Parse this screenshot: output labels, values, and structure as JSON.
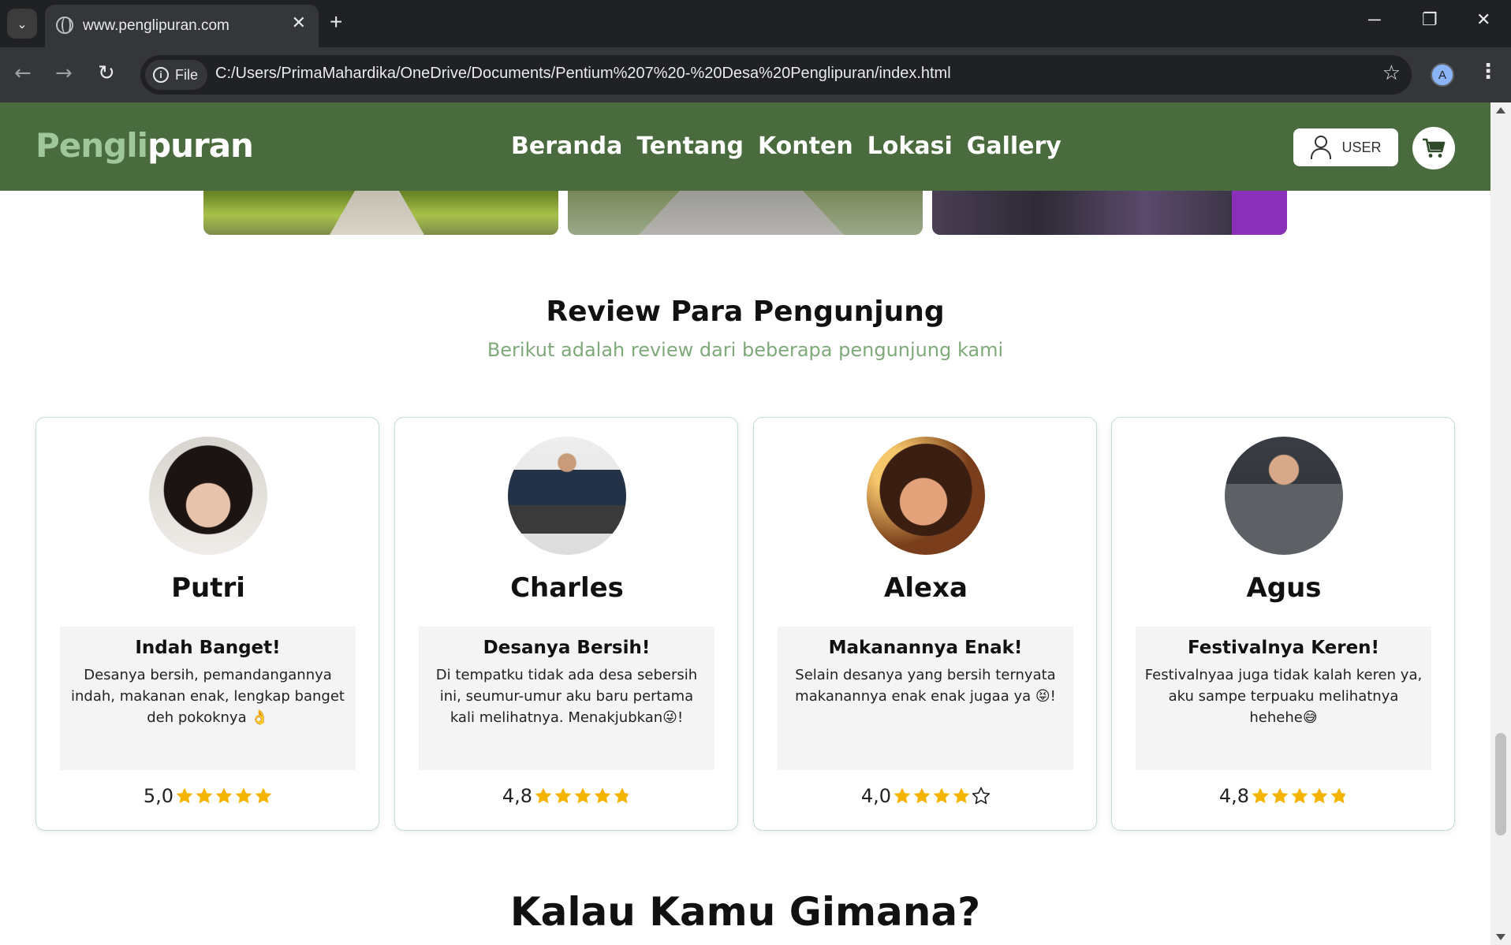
{
  "browser": {
    "tab_title": "www.penglipuran.com",
    "omnibox_chip": "File",
    "url": "C:/Users/PrimaMahardika/OneDrive/Documents/Pentium%207%20-%20Desa%20Penglipuran/index.html",
    "profile_initial": "A"
  },
  "site": {
    "logo_part1": "Pengli",
    "logo_part2": "puran",
    "nav": [
      "Beranda",
      "Tentang",
      "Konten",
      "Lokasi",
      "Gallery"
    ],
    "user_label": "USER",
    "colors": {
      "header": "#4a6b3d",
      "accent": "#7fa97a",
      "star": "#f5b301"
    }
  },
  "reviews": {
    "title": "Review Para Pengunjung",
    "subtitle": "Berikut adalah review dari beberapa pengunjung kami",
    "cards": [
      {
        "name": "Putri",
        "review_title": "Indah Banget!",
        "review_text": "Desanya bersih, pemandangannya indah, makanan enak, lengkap banget deh pokoknya 👌",
        "rating_label": "5,0",
        "rating": 5.0
      },
      {
        "name": "Charles",
        "review_title": "Desanya Bersih!",
        "review_text": "Di tempatku tidak ada desa sebersih ini, seumur-umur aku baru pertama kali melihatnya. Menakjubkan😜!",
        "rating_label": "4,8",
        "rating": 4.8
      },
      {
        "name": "Alexa",
        "review_title": "Makanannya Enak!",
        "review_text": "Selain desanya yang bersih ternyata makanannya enak enak jugaa ya 😝!",
        "rating_label": "4,0",
        "rating": 4.0
      },
      {
        "name": "Agus",
        "review_title": "Festivalnya Keren!",
        "review_text": "Festivalnyaa juga tidak kalah keren ya, aku sampe terpuaku melihatnya hehehe😅",
        "rating_label": "4,8",
        "rating": 4.8
      }
    ]
  },
  "next_section_title": "Kalau Kamu Gimana?"
}
